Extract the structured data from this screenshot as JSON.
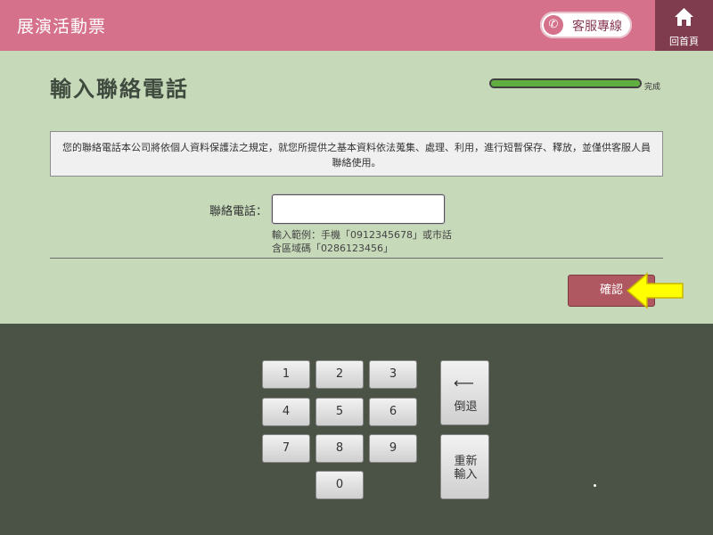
{
  "header": {
    "title": "展演活動票",
    "service_label": "客服專線",
    "home_label": "回首頁"
  },
  "page": {
    "title": "輸入聯絡電話",
    "progress_label": "完成",
    "progress_fraction": 1.0
  },
  "notice": {
    "text": "您的聯絡電話本公司將依個人資料保護法之規定，就您所提供之基本資料依法蒐集、處理、利用，進行短暫保存、釋放，並僅供客服人員聯絡使用。"
  },
  "form": {
    "phone_label": "聯絡電話：",
    "phone_value": "",
    "hint_line1": "輸入範例：手機「0912345678」或市話",
    "hint_line2": "含區域碼「0286123456」"
  },
  "confirm_label": "確認",
  "keypad": {
    "keys": [
      "1",
      "2",
      "3",
      "4",
      "5",
      "6",
      "7",
      "8",
      "9",
      "0"
    ],
    "backspace_arrow": "⟵",
    "backspace_label": "倒退",
    "reset_line1": "重新",
    "reset_line2": "輸入"
  },
  "colors": {
    "header": "#d5718b",
    "content_bg": "#c6d9b9",
    "keypad_bg": "#4b5246",
    "confirm": "#b05862",
    "highlight_arrow": "#ffff00"
  },
  "icons": {
    "service": "phone-icon",
    "home": "home-icon",
    "pointer": "arrow-left-icon"
  }
}
